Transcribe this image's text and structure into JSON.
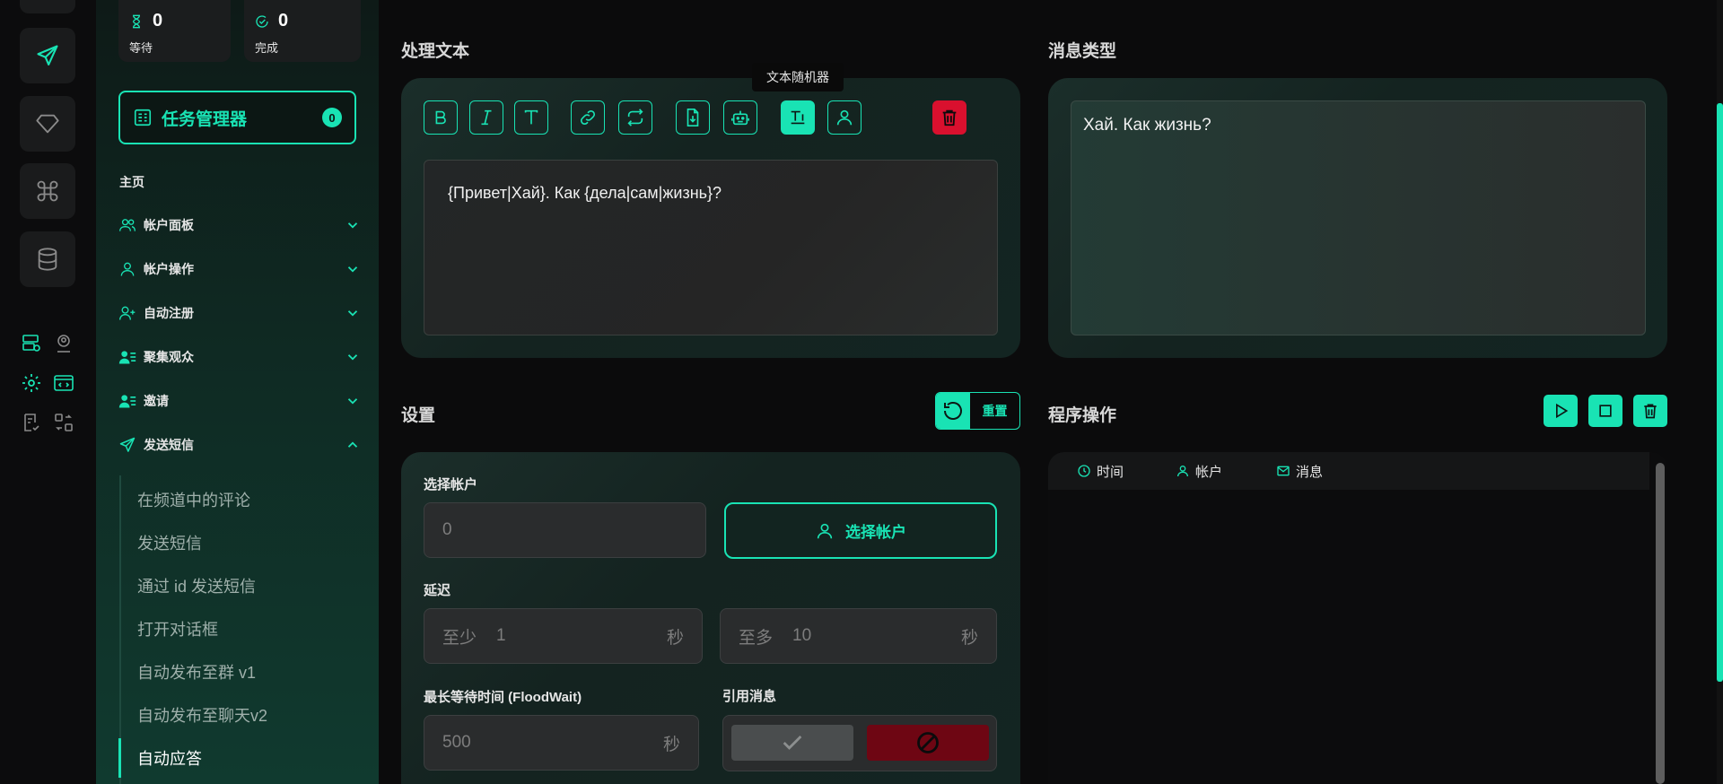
{
  "stats": {
    "waiting": {
      "value": "0",
      "label": "等待"
    },
    "done": {
      "value": "0",
      "label": "完成"
    }
  },
  "task_manager": {
    "label": "任务管理器",
    "count": "0"
  },
  "sidebar": {
    "home": "主页",
    "items": [
      {
        "label": "帐户面板"
      },
      {
        "label": "帐户操作"
      },
      {
        "label": "自动注册"
      },
      {
        "label": "聚集观众"
      },
      {
        "label": "邀请"
      },
      {
        "label": "发送短信"
      }
    ],
    "sub_items": [
      {
        "label": "在频道中的评论"
      },
      {
        "label": "发送短信"
      },
      {
        "label": "通过 id 发送短信"
      },
      {
        "label": "打开对话框"
      },
      {
        "label": "自动发布至群 v1"
      },
      {
        "label": "自动发布至聊天v2"
      },
      {
        "label": "自动应答"
      }
    ]
  },
  "process_text": {
    "title": "处理文本",
    "tooltip": "文本随机器",
    "content": "{Привет|Хай}. Как {дела|сам|жизнь}?"
  },
  "message_type": {
    "title": "消息类型",
    "preview": "Хай. Как жизнь?"
  },
  "settings": {
    "title": "设置",
    "reset_label": "重置",
    "select_account_label": "选择帐户",
    "account_count": "0",
    "select_account_button": "选择帐户",
    "delay_label": "延迟",
    "delay_min_prefix": "至少",
    "delay_min": "1",
    "delay_max_prefix": "至多",
    "delay_max": "10",
    "unit_seconds": "秒",
    "floodwait_label": "最长等待时间 (FloodWait)",
    "floodwait_value": "500",
    "quote_label": "引用消息"
  },
  "program_ops": {
    "title": "程序操作",
    "columns": [
      "时间",
      "帐户",
      "消息"
    ]
  },
  "colors": {
    "accent": "#19e3b4",
    "danger": "#d9102e",
    "danger_dark": "#6e0613"
  }
}
